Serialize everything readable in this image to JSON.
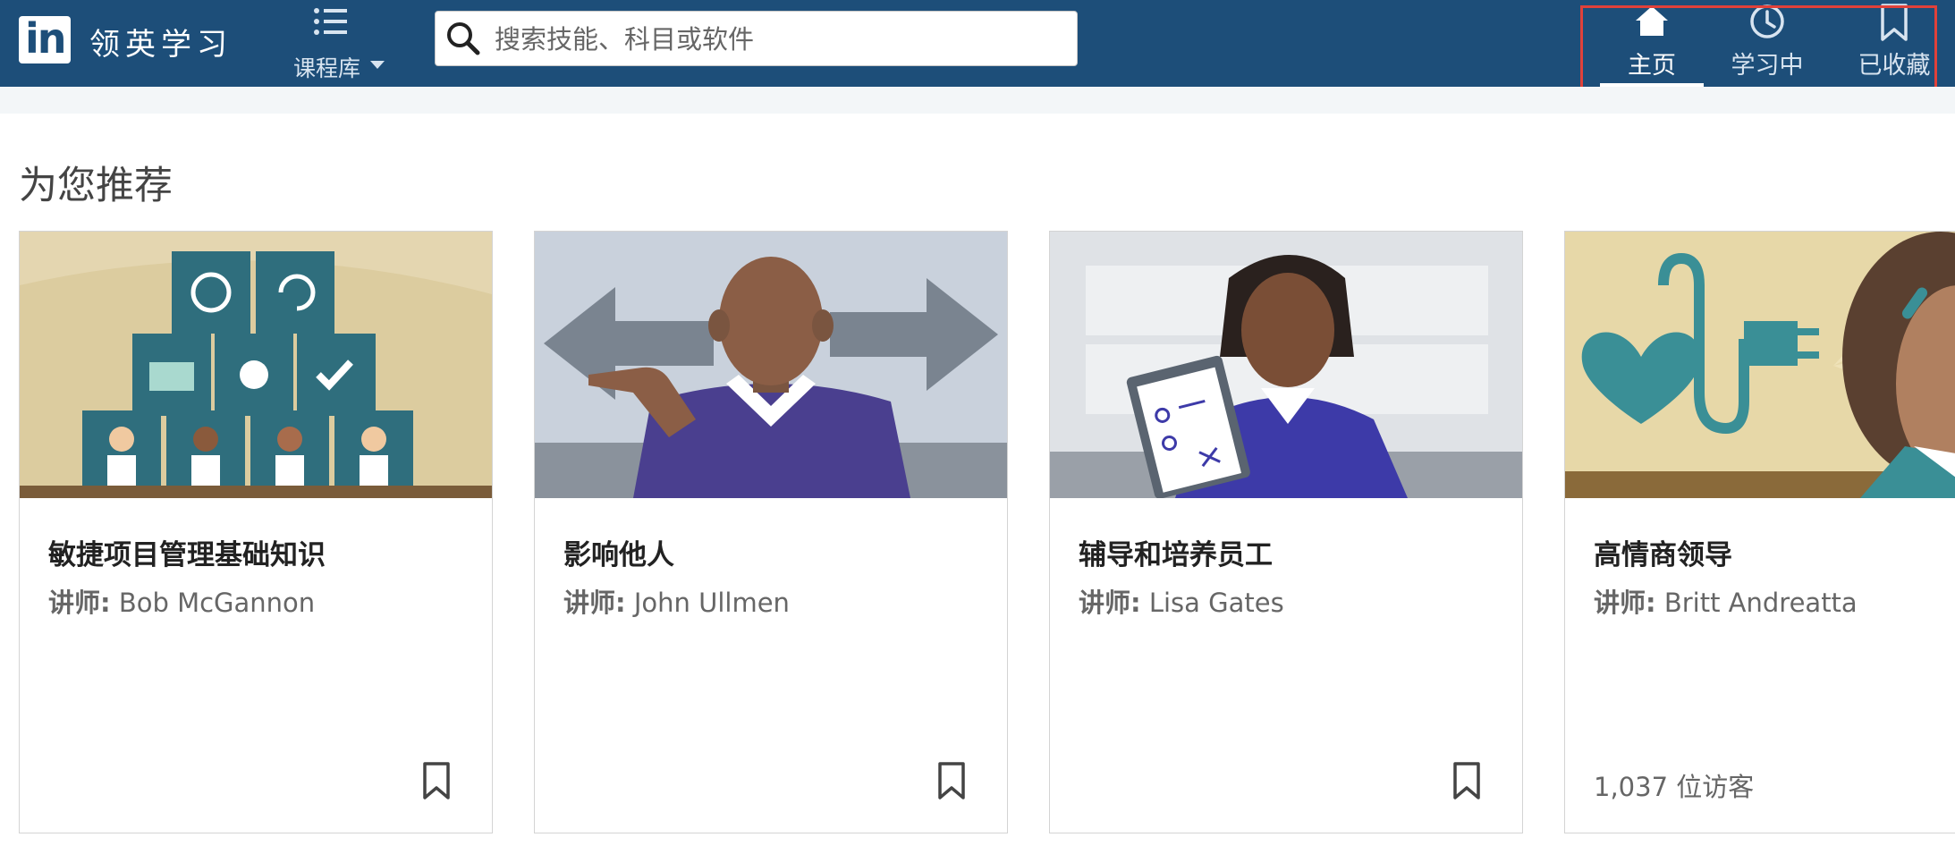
{
  "header": {
    "logo_text": "in",
    "brand": "领英学习",
    "library_label": "课程库",
    "search_placeholder": "搜索技能、科目或软件",
    "nav": {
      "home": "主页",
      "learning": "学习中",
      "saved": "已收藏"
    }
  },
  "section": {
    "title": "为您推荐"
  },
  "instructor_prefix": "讲师:",
  "cards": [
    {
      "title": "敏捷项目管理基础知识",
      "instructor": "Bob McGannon"
    },
    {
      "title": "影响他人",
      "instructor": "John Ullmen"
    },
    {
      "title": "辅导和培养员工",
      "instructor": "Lisa Gates"
    },
    {
      "title": "高情商领导",
      "instructor": "Britt Andreatta",
      "visitors": "1,037 位访客"
    }
  ],
  "colors": {
    "header_bg": "#1d4e79",
    "highlight_border": "#e0413a"
  }
}
